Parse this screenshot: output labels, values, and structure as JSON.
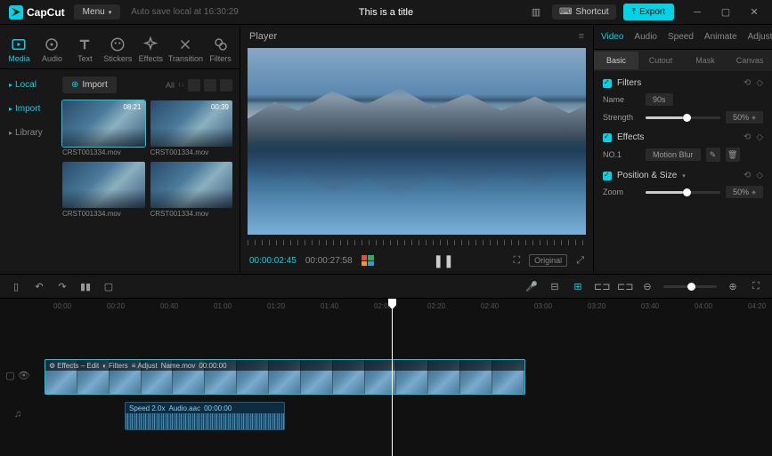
{
  "titlebar": {
    "brand": "CapCut",
    "menu": "Menu",
    "autosave": "Auto save local at 16:30:29",
    "title": "This is a title",
    "shortcut": "Shortcut",
    "export": "Export"
  },
  "tools": {
    "media": "Media",
    "audio": "Audio",
    "text": "Text",
    "stickers": "Stickers",
    "effects": "Effects",
    "transition": "Transition",
    "filters": "Filters"
  },
  "mediaSide": {
    "local": "Local",
    "import": "Import",
    "library": "Library"
  },
  "mediaTop": {
    "import": "Import",
    "all": "All"
  },
  "clips": [
    {
      "name": "CRST001334.mov",
      "dur": "08:21"
    },
    {
      "name": "CRST001334.mov",
      "dur": "00:39"
    },
    {
      "name": "CRST001334.mov",
      "dur": ""
    },
    {
      "name": "CRST001334.mov",
      "dur": ""
    }
  ],
  "player": {
    "label": "Player",
    "current": "00:00:02:45",
    "total": "00:00:27:58",
    "original": "Original"
  },
  "propTabs": {
    "video": "Video",
    "audio": "Audio",
    "speed": "Speed",
    "animate": "Animate",
    "adjust": "Adjust"
  },
  "subTabs": {
    "basic": "Basic",
    "cutout": "Cutout",
    "mask": "Mask",
    "canvas": "Canvas"
  },
  "filters": {
    "title": "Filters",
    "nameLbl": "Name",
    "nameVal": "90s",
    "strengthLbl": "Strength",
    "strengthVal": "50%"
  },
  "effects": {
    "title": "Effects",
    "no1": "NO.1",
    "val": "Motion Blur"
  },
  "position": {
    "title": "Position & Size",
    "zoomLbl": "Zoom",
    "zoomVal": "50%"
  },
  "tlRuler": [
    "00:00",
    "00:20",
    "00:40",
    "01:00",
    "01:20",
    "01:40",
    "02:00",
    "02:20",
    "02:40",
    "03:00",
    "03:20",
    "03:40",
    "04:00",
    "04:20"
  ],
  "videoClip": {
    "effects": "Effects – Edit",
    "filters": "Filters",
    "adjust": "Adjust",
    "name": "Name.mov",
    "dur": "00:00:00"
  },
  "audioClip": {
    "speed": "Speed 2.0x",
    "name": "Audio.aac",
    "dur": "00:00:00"
  }
}
